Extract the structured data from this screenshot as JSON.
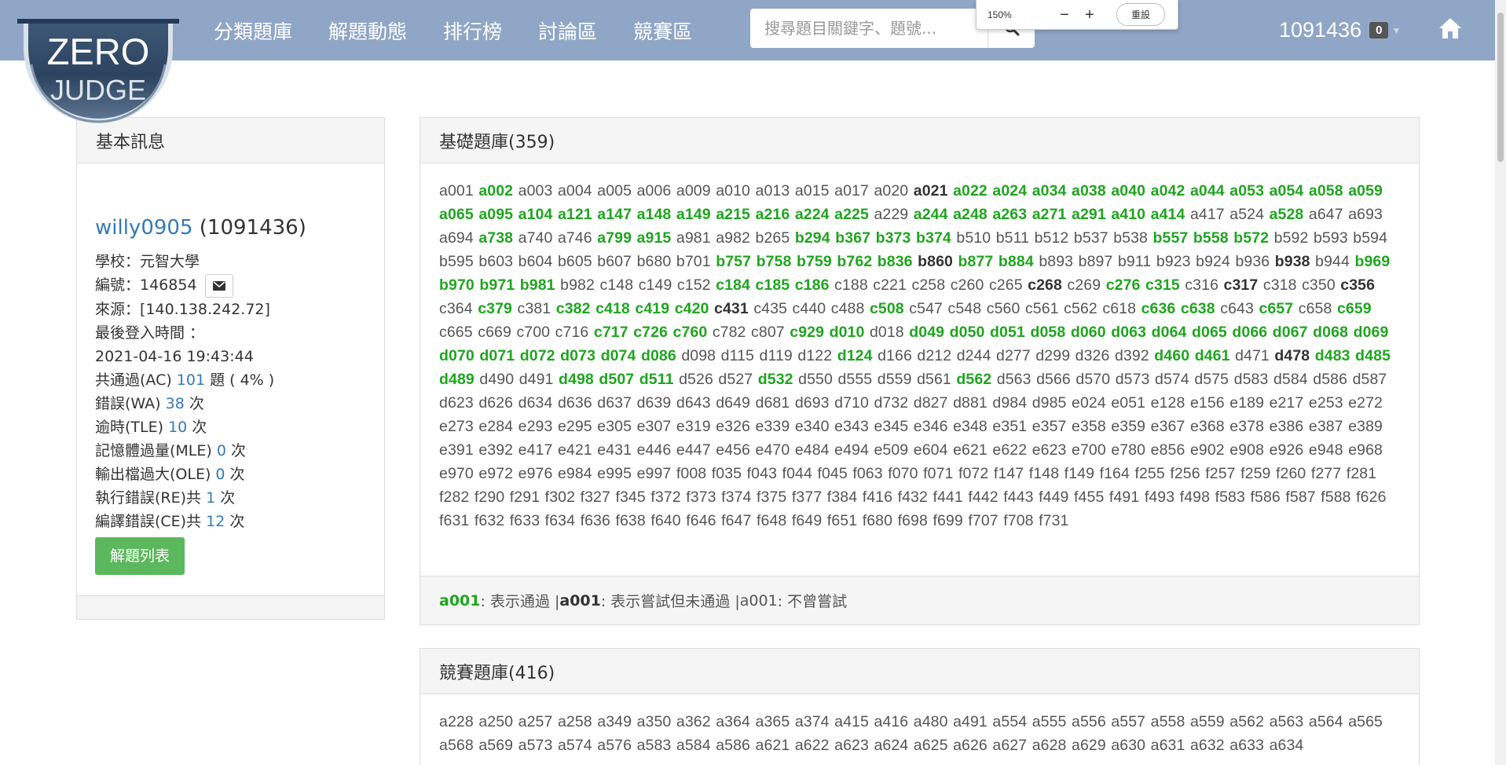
{
  "nav": {
    "links": [
      "分類題庫",
      "解題動態",
      "排行榜",
      "討論區",
      "競賽區"
    ],
    "search_placeholder": "搜尋題目關鍵字、題號...",
    "user_id": "1091436",
    "badge": "0",
    "logo_top": "ZERO",
    "logo_bottom": "JUDGE"
  },
  "zoom": {
    "level": "150%",
    "minus": "−",
    "plus": "+",
    "reset": "重設"
  },
  "profile": {
    "heading": "基本訊息",
    "username": "willy0905",
    "user_id_paren": "(1091436)",
    "school": "學校：元智大學",
    "number": "編號：146854",
    "source": "來源：[140.138.242.72]",
    "last_login_label": "最後登入時間 ：",
    "last_login": "2021-04-16 19:43:44",
    "ac_label": "共通過(AC) ",
    "ac_value": "101",
    "ac_suffix": " 題 ( 4% )",
    "wa_label": "錯誤(WA) ",
    "wa_value": "38",
    "tle_label": "逾時(TLE) ",
    "tle_value": "10",
    "mle_label": "記憶體過量(MLE) ",
    "mle_value": "0",
    "ole_label": "輸出檔過大(OLE) ",
    "ole_value": "0",
    "re_label": "執行錯誤(RE)共 ",
    "re_value": "1",
    "ce_label": "編譯錯誤(CE)共 ",
    "ce_value": "12",
    "times_unit": " 次",
    "list_button": "解題列表"
  },
  "basic": {
    "heading": "基礎題庫(359)",
    "problems": "a001 a002:ac a003 a004 a005 a006 a009 a010 a013 a015 a017 a020 a021:tried a022:ac a024:ac a034:ac a038:ac a040:ac a042:ac a044:ac a053:ac a054:ac a058:ac a059:ac a065:ac a095:ac a104:ac a121:ac a147:ac a148:ac a149:ac a215:ac a216:ac a224:ac a225:ac a229 a244:ac a248:ac a263:ac a271:ac a291:ac a410:ac a414:ac a417 a524 a528:ac a647 a693 a694 a738:ac a740 a746 a799:ac a915:ac a981 a982 b265 b294:ac b367:ac b373:ac b374:ac b510 b511 b512 b537 b538 b557:ac b558:ac b572:ac b592 b593 b594 b595 b603 b604 b605 b607 b680 b701 b757:ac b758:ac b759:ac b762:ac b836:ac b860:tried b877:ac b884:ac b893 b897 b911 b923 b924 b936 b938:tried b944 b969:ac b970:ac b971:ac b981:ac b982 c148 c149 c152 c184:ac c185:ac c186:ac c188 c221 c258 c260 c265 c268:tried c269 c276:ac c315:ac c316 c317:tried c318 c350 c356:tried c364 c379:ac c381 c382:ac c418:ac c419:ac c420:ac c431:tried c435 c440 c488 c508:ac c547 c548 c560 c561 c562 c618 c636:ac c638:ac c643 c657:ac c658 c659:ac c665 c669 c700 c716 c717:ac c726:ac c760:ac c782 c807 c929:ac d010:ac d018 d049:ac d050:ac d051:ac d058:ac d060:ac d063:ac d064:ac d065:ac d066:ac d067:ac d068:ac d069:ac d070:ac d071:ac d072:ac d073:ac d074:ac d086:ac d098 d115 d119 d122 d124:ac d166 d212 d244 d277 d299 d326 d392 d460:ac d461:ac d471 d478:tried d483:ac d485:ac d489:ac d490 d491 d498:ac d507:ac d511:ac d526 d527 d532:ac d550 d555 d559 d561 d562:ac d563 d566 d570 d573 d574 d575 d583 d584 d586 d587 d623 d626 d634 d636 d637 d639 d643 d649 d681 d693 d710 d732 d827 d881 d984 d985 e024 e051 e128 e156 e189 e217 e253 e272 e273 e284 e293 e295 e305 e307 e319 e326 e339 e340 e343 e345 e346 e348 e351 e357 e358 e359 e367 e368 e378 e386 e387 e389 e391 e392 e417 e421 e431 e446 e447 e456 e470 e484 e494 e509 e604 e621 e622 e623 e700 e780 e856 e902 e908 e926 e948 e968 e970 e972 e976 e984 e995 e997 f008 f035 f043 f044 f045 f063 f070 f071 f072 f147 f148 f149 f164 f255 f256 f257 f259 f260 f277 f281 f282 f290 f291 f302 f327 f345 f372 f373 f374 f375 f377 f384 f416 f432 f441 f442 f443 f449 f455 f491 f493 f498 f583 f586 f587 f588 f626 f631 f632 f633 f634 f636 f638 f640 f646 f647 f648 f649 f651 f680 f698 f699 f707 f708 f731",
    "legend": {
      "ac_code": "a001",
      "ac_text": ": 表示通過 | ",
      "tried_code": "a001",
      "tried_text": ": 表示嘗試但未通過 | ",
      "none_code": "a001",
      "none_text": ": 不曾嘗試"
    }
  },
  "contest": {
    "heading": "競賽題庫(416)",
    "problems": "a228 a250 a257 a258 a349 a350 a362 a364 a365 a374 a415 a416 a480 a491 a554 a555 a556 a557 a558 a559 a562 a563 a564 a565 a568 a569 a573 a574 a576 a583 a584 a586 a621 a622 a623 a624 a625 a626 a627 a628 a629 a630 a631 a632 a633 a634"
  },
  "colors": {
    "navbar": "#90a6c6",
    "accepted": "#1fa51f",
    "link": "#337ab7",
    "button": "#5cb85c"
  },
  "icons": {
    "search": "search-icon",
    "mail": "envelope-icon",
    "home": "home-icon",
    "caret": "caret-down-icon"
  }
}
